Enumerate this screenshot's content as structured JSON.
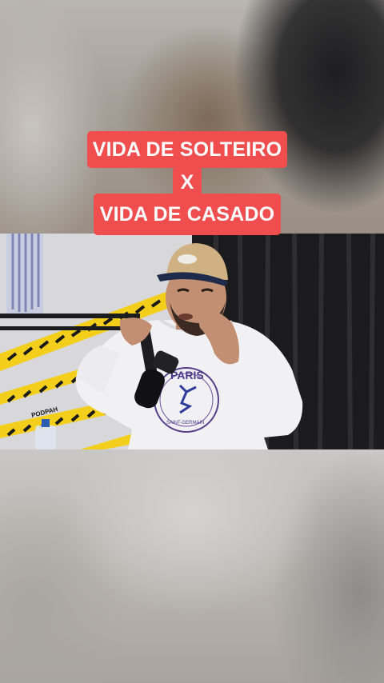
{
  "captions": {
    "line1": "VIDA DE SOLTEIRO",
    "separator": "X",
    "line2": "VIDA DE CASADO"
  },
  "video_scene": {
    "shirt_logo_text": "PARIS",
    "shirt_sub_text": "SAINT-GERMAIN",
    "tape_text": "PODPAH"
  },
  "colors": {
    "caption_background": "#f04e4e",
    "caption_text": "#ffffff",
    "tape_yellow": "#f3cf1c",
    "curtain": "#1b1b1d"
  }
}
